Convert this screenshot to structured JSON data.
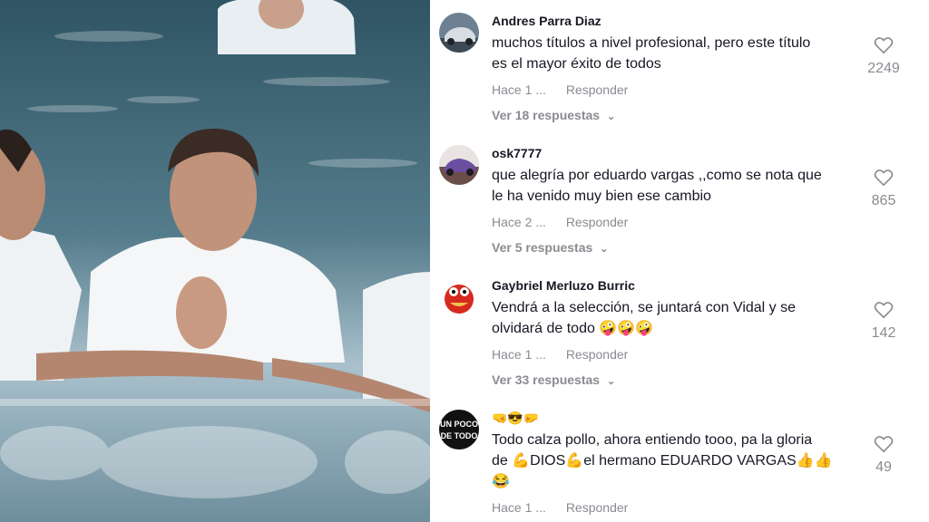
{
  "comments": [
    {
      "username": "Andres Parra Diaz",
      "text_line1": "muchos títulos a nivel profesional, pero este título",
      "text_line2": "es el mayor éxito de todos",
      "time": "Hace 1 ...",
      "reply": "Responder",
      "view_replies": "Ver 18 respuestas",
      "likes": "2249"
    },
    {
      "username": "osk7777",
      "text_line1": "que alegría por eduardo vargas ,,como se nota que",
      "text_line2": "le ha venido muy bien ese cambio",
      "time": "Hace 2 ...",
      "reply": "Responder",
      "view_replies": "Ver 5 respuestas",
      "likes": "865"
    },
    {
      "username": "Gaybriel Merluzo Burric",
      "text_line1": "Vendrá a la selección, se juntará con Vidal y se",
      "text_line2": "olvidará de todo",
      "text_line2_emoji": "🤪🤪🤪",
      "time": "Hace 1 ...",
      "reply": "Responder",
      "view_replies": "Ver 33 respuestas",
      "likes": "142"
    },
    {
      "username_emoji": "🤜😎🤛",
      "text_line1": "Todo calza pollo, ahora entiendo tooo, pa la gloria",
      "text_line2_a": "de ",
      "text_line2_emoji_a": "💪",
      "text_line2_b": "DIOS",
      "text_line2_emoji_b": "💪",
      "text_line2_c": "el hermano EDUARDO VARGAS",
      "text_line2_emoji_c": "👍👍",
      "text_line3_emoji": "😂",
      "time": "Hace 1 ...",
      "reply": "Responder",
      "likes": "49",
      "avatar_text": "UN POCO DE TODO"
    }
  ],
  "colors": {
    "text": "#161823",
    "muted": "#8a8b91"
  },
  "icons": {
    "like": "heart-outline-icon"
  }
}
